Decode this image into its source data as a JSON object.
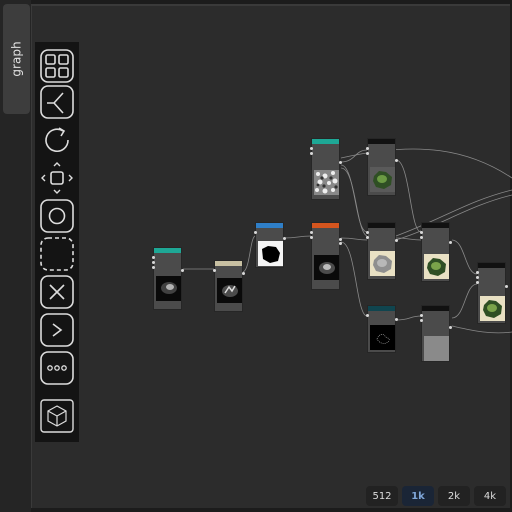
{
  "side_tab": {
    "label": "graph"
  },
  "toolbar": {
    "tools": [
      {
        "icon": "grid-icon"
      },
      {
        "icon": "branch-icon"
      },
      {
        "icon": "rotate-icon"
      },
      {
        "icon": "move-icon"
      },
      {
        "icon": "circle-icon"
      },
      {
        "icon": "dashed-rect-icon"
      },
      {
        "icon": "close-x-icon"
      },
      {
        "icon": "chevron-right-icon"
      },
      {
        "icon": "more-dots-icon"
      },
      {
        "icon": "cube-icon"
      }
    ]
  },
  "colors": {
    "teal": "#1ea896",
    "blue": "#2f7fc8",
    "orange": "#d4551e",
    "beige": "#c8c0a2",
    "black": "#111111",
    "darkteal": "#10454f"
  },
  "resolutions": {
    "r512": "512",
    "r1k": "1k",
    "r2k": "2k",
    "r4k": "4k",
    "active": "1k"
  }
}
